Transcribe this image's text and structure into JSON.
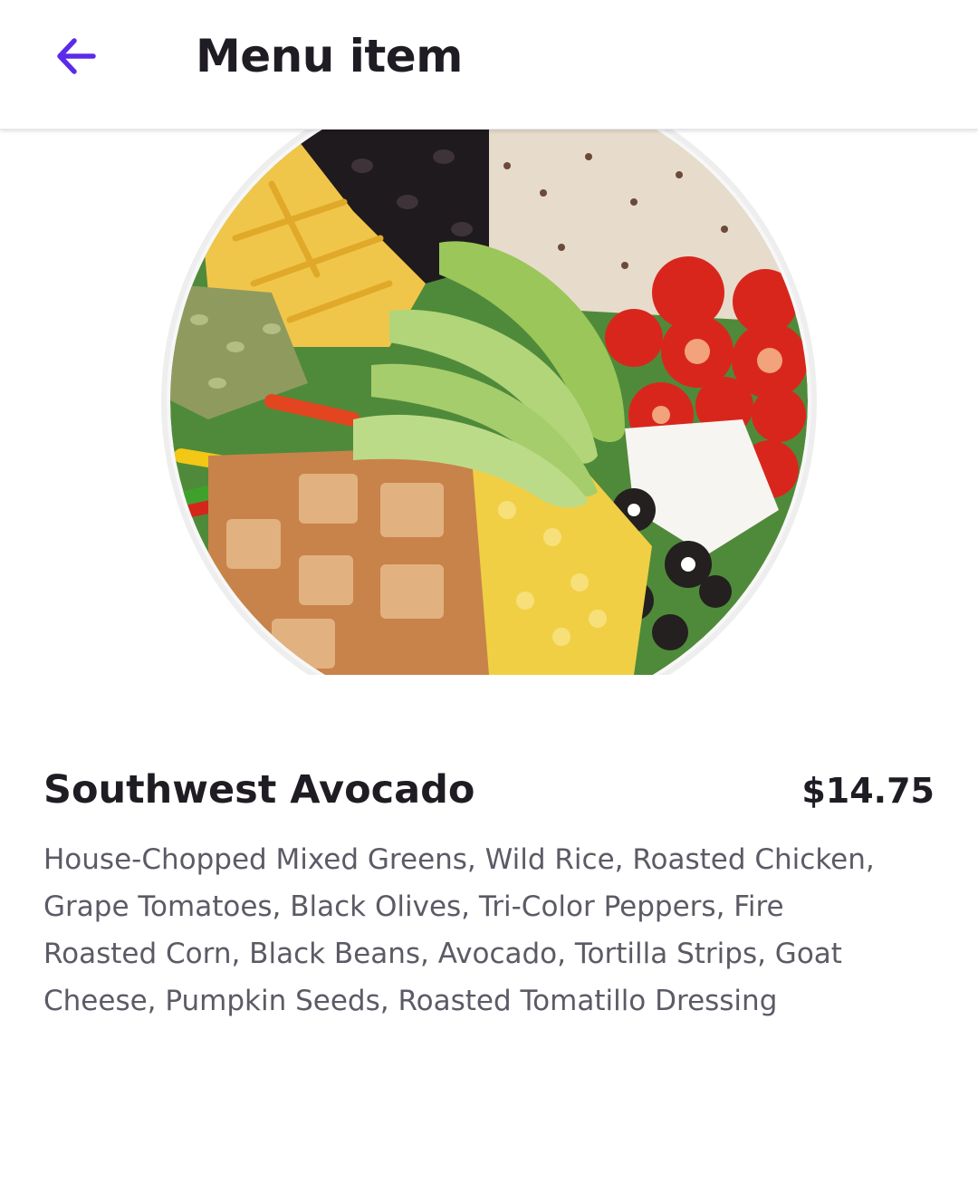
{
  "header": {
    "back_icon": "arrow-left-icon",
    "title": "Menu item"
  },
  "colors": {
    "accent": "#5b2be8",
    "text_primary": "#1f1c24",
    "text_secondary": "#5d5a66"
  },
  "item": {
    "image": "salad-bowl-photo",
    "name": "Southwest Avocado",
    "price": "$14.75",
    "description": "House-Chopped Mixed Greens, Wild Rice, Roasted Chicken, Grape Tomatoes, Black Olives, Tri-Color Peppers, Fire Roasted Corn, Black Beans, Avocado, Tortilla Strips, Goat Cheese, Pumpkin Seeds, Roasted Tomatillo Dressing"
  }
}
